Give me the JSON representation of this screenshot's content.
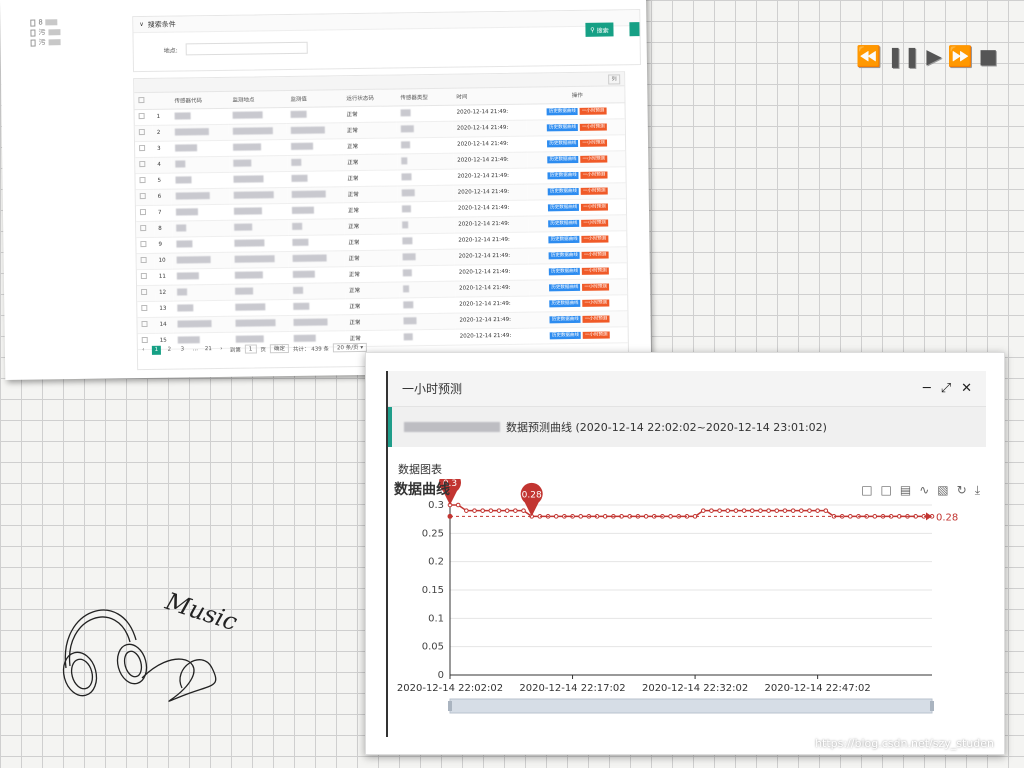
{
  "back": {
    "tree_items": [
      "8",
      "污",
      "污"
    ],
    "search": {
      "header": "搜索条件",
      "location_label": "地点:",
      "search_button": "搜索"
    },
    "grid": {
      "cols_button": "列",
      "headers": [
        "传感器代码",
        "监测地点",
        "监测值",
        "运行状态码",
        "传感器类型",
        "时间",
        "操作"
      ],
      "rows": [
        {
          "n": "1",
          "status": "正常",
          "time": "2020-12-14 21:49:"
        },
        {
          "n": "2",
          "status": "正常",
          "time": "2020-12-14 21:49:"
        },
        {
          "n": "3",
          "status": "正常",
          "time": "2020-12-14 21:49:"
        },
        {
          "n": "4",
          "status": "正常",
          "time": "2020-12-14 21:49:"
        },
        {
          "n": "5",
          "status": "正常",
          "time": "2020-12-14 21:49:"
        },
        {
          "n": "6",
          "status": "正常",
          "time": "2020-12-14 21:49:"
        },
        {
          "n": "7",
          "status": "正常",
          "time": "2020-12-14 21:49:"
        },
        {
          "n": "8",
          "status": "正常",
          "time": "2020-12-14 21:49:"
        },
        {
          "n": "9",
          "status": "正常",
          "time": "2020-12-14 21:49:"
        },
        {
          "n": "10",
          "status": "正常",
          "time": "2020-12-14 21:49:"
        },
        {
          "n": "11",
          "status": "正常",
          "time": "2020-12-14 21:49:"
        },
        {
          "n": "12",
          "status": "正常",
          "time": "2020-12-14 21:49:"
        },
        {
          "n": "13",
          "status": "正常",
          "time": "2020-12-14 21:49:"
        },
        {
          "n": "14",
          "status": "正常",
          "time": "2020-12-14 21:49:"
        },
        {
          "n": "15",
          "status": "正常",
          "time": "2020-12-14 21:49:"
        }
      ],
      "op_history": "历史数据曲线",
      "op_predict": "一小时预测"
    },
    "pager": {
      "prev": "‹",
      "pages": [
        "1",
        "2",
        "3",
        "...",
        "21"
      ],
      "next": "›",
      "goto_label": "到第",
      "goto_value": "1",
      "page_unit": "页",
      "confirm": "确定",
      "total": "共计： 439 条",
      "page_size": "20 条/页"
    }
  },
  "media_icons": [
    "rewind-icon",
    "pause-icon",
    "play-icon",
    "fast-forward-icon",
    "stop-icon"
  ],
  "doodle_text": "Music",
  "modal": {
    "title": "一小时预测",
    "header_text": "数据预测曲线 (2020-12-14 22:02:02~2020-12-14 23:01:02)",
    "section_label": "数据图表"
  },
  "watermark": "https://blog.csdn.net/szy_studen",
  "chart_data": {
    "type": "line",
    "title": "数据曲线",
    "ylim": [
      0,
      0.3
    ],
    "yticks": [
      "0",
      "0.05",
      "0.1",
      "0.15",
      "0.2",
      "0.25",
      "0.3"
    ],
    "xticks": [
      "2020-12-14 22:02:02",
      "2020-12-14 22:17:02",
      "2020-12-14 22:32:02",
      "2020-12-14 22:47:02"
    ],
    "x_minutes_range": [
      0,
      59
    ],
    "series": [
      {
        "values": [
          0.3,
          0.3,
          0.29,
          0.29,
          0.29,
          0.29,
          0.29,
          0.29,
          0.29,
          0.29,
          0.28,
          0.28,
          0.28,
          0.28,
          0.28,
          0.28,
          0.28,
          0.28,
          0.28,
          0.28,
          0.28,
          0.28,
          0.28,
          0.28,
          0.28,
          0.28,
          0.28,
          0.28,
          0.28,
          0.28,
          0.28,
          0.29,
          0.29,
          0.29,
          0.29,
          0.29,
          0.29,
          0.29,
          0.29,
          0.29,
          0.29,
          0.29,
          0.29,
          0.29,
          0.29,
          0.29,
          0.29,
          0.28,
          0.28,
          0.28,
          0.28,
          0.28,
          0.28,
          0.28,
          0.28,
          0.28,
          0.28,
          0.28,
          0.28,
          0.28
        ],
        "color": "#c23531"
      }
    ],
    "markpoints": [
      {
        "index": 0,
        "value": "0.3"
      },
      {
        "index": 10,
        "value": "0.28"
      }
    ],
    "markline": {
      "value": 0.28,
      "label": "0.28"
    },
    "grid": true,
    "toolbox_icons": [
      "zoom-icon",
      "zoom-reset-icon",
      "data-view-icon",
      "line-type-icon",
      "bar-type-icon",
      "restore-icon",
      "save-image-icon"
    ]
  }
}
